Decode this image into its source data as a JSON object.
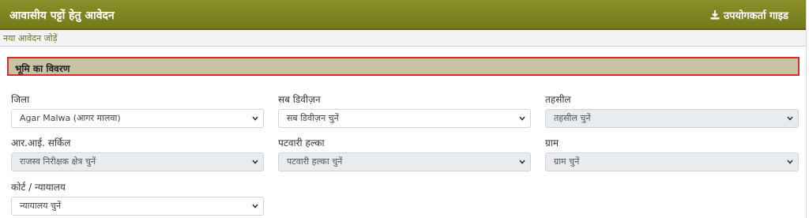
{
  "header": {
    "title": "आवासीय पट्टों हेतु आवेदन",
    "user_guide_label": "उपयोगकर्ता गाइड"
  },
  "subnav": {
    "new_application_label": "नया आवेदन जोड़ें"
  },
  "section": {
    "title": "भूमि का विवरण"
  },
  "fields": {
    "district": {
      "label": "जिला",
      "value": "Agar Malwa (आगर मालवा)"
    },
    "subdivision": {
      "label": "सब डिवीज़न",
      "value": "सब डिवीज़न चुनें"
    },
    "tehsil": {
      "label": "तहसील",
      "value": "तहसील चुनें"
    },
    "ri_circle": {
      "label": "आर.आई. सर्किल",
      "value": "राजस्व निरीक्षक क्षेत्र चुनें"
    },
    "patwari_halka": {
      "label": "पटवारी हल्का",
      "value": "पटवारी हल्का चुनें"
    },
    "village": {
      "label": "ग्राम",
      "value": "ग्राम चुनें"
    },
    "court": {
      "label": "कोर्ट / न्यायालय",
      "value": "न्यायालय चुनें"
    }
  },
  "icons": {
    "download": "download-icon",
    "chevron": "chevron-down-icon"
  },
  "colors": {
    "header_bg": "#7f851f",
    "section_bg": "#c5c4a4",
    "section_border": "#e2262b",
    "disabled_bg": "#e9ecef"
  }
}
